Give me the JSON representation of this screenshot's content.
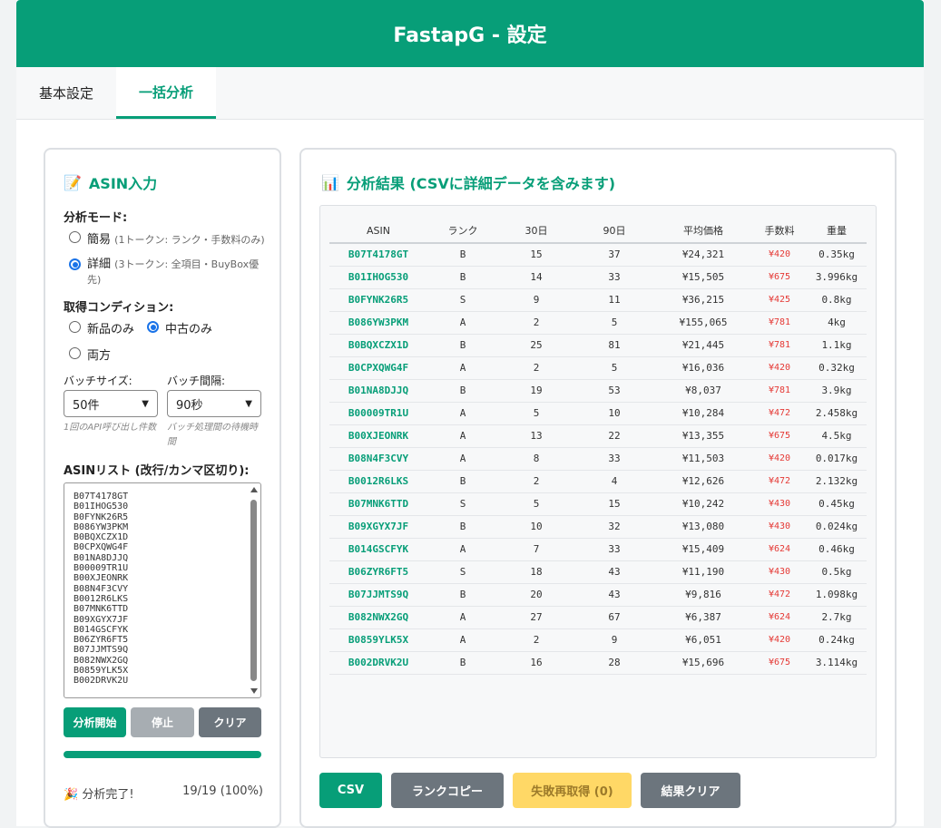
{
  "header": {
    "title": "FastapG - 設定"
  },
  "tabs": [
    {
      "label": "基本設定",
      "active": false
    },
    {
      "label": "一括分析",
      "active": true
    }
  ],
  "left": {
    "title": "ASIN入力",
    "title_icon": "memo-icon",
    "mode_label": "分析モード:",
    "mode_simple": {
      "label": "簡易",
      "note": "(1トークン: ランク・手数料のみ)",
      "checked": false
    },
    "mode_detail": {
      "label": "詳細",
      "note": "(3トークン: 全項目・BuyBox優先)",
      "checked": true
    },
    "condition_label": "取得コンディション:",
    "cond_new": {
      "label": "新品のみ",
      "checked": false
    },
    "cond_used": {
      "label": "中古のみ",
      "checked": true
    },
    "cond_both": {
      "label": "両方",
      "checked": false
    },
    "batch_size_label": "バッチサイズ:",
    "batch_size_value": "50件",
    "batch_size_hint": "1回のAPI呼び出し件数",
    "batch_interval_label": "バッチ間隔:",
    "batch_interval_value": "90秒",
    "batch_interval_hint": "バッチ処理間の待機時間",
    "asin_list_label": "ASINリスト (改行/カンマ区切り):",
    "asin_list": "B07T4178GT\nB01IHOG530\nB0FYNK26R5\nB086YW3PKM\nB0BQXCZX1D\nB0CPXQWG4F\nB01NA8DJJQ\nB00009TR1U\nB00XJEONRK\nB08N4F3CVY\nB0012R6LKS\nB07MNK6TTD\nB09XGYX7JF\nB014GSCFYK\nB06ZYR6FT5\nB07JJMTS9Q\nB082NWX2GQ\nB0859YLK5X\nB002DRVK2U",
    "btn_start": "分析開始",
    "btn_stop": "停止",
    "btn_clear": "クリア",
    "progress": 100,
    "status_text": "分析完了!",
    "status_icon": "party-popper-icon",
    "status_count": "19/19 (100%)"
  },
  "right": {
    "title": "分析結果 (CSVに詳細データを含みます)",
    "title_icon": "bar-chart-icon",
    "columns": [
      "ASIN",
      "ランク",
      "30日",
      "90日",
      "平均価格",
      "手数料",
      "重量"
    ],
    "rows": [
      [
        "B07T4178GT",
        "B",
        "15",
        "37",
        "¥24,321",
        "¥420",
        "0.35kg"
      ],
      [
        "B01IHOG530",
        "B",
        "14",
        "33",
        "¥15,505",
        "¥675",
        "3.996kg"
      ],
      [
        "B0FYNK26R5",
        "S",
        "9",
        "11",
        "¥36,215",
        "¥425",
        "0.8kg"
      ],
      [
        "B086YW3PKM",
        "A",
        "2",
        "5",
        "¥155,065",
        "¥781",
        "4kg"
      ],
      [
        "B0BQXCZX1D",
        "B",
        "25",
        "81",
        "¥21,445",
        "¥781",
        "1.1kg"
      ],
      [
        "B0CPXQWG4F",
        "A",
        "2",
        "5",
        "¥16,036",
        "¥420",
        "0.32kg"
      ],
      [
        "B01NA8DJJQ",
        "B",
        "19",
        "53",
        "¥8,037",
        "¥781",
        "3.9kg"
      ],
      [
        "B00009TR1U",
        "A",
        "5",
        "10",
        "¥10,284",
        "¥472",
        "2.458kg"
      ],
      [
        "B00XJEONRK",
        "A",
        "13",
        "22",
        "¥13,355",
        "¥675",
        "4.5kg"
      ],
      [
        "B08N4F3CVY",
        "A",
        "8",
        "33",
        "¥11,503",
        "¥420",
        "0.017kg"
      ],
      [
        "B0012R6LKS",
        "B",
        "2",
        "4",
        "¥12,626",
        "¥472",
        "2.132kg"
      ],
      [
        "B07MNK6TTD",
        "S",
        "5",
        "15",
        "¥10,242",
        "¥430",
        "0.45kg"
      ],
      [
        "B09XGYX7JF",
        "B",
        "10",
        "32",
        "¥13,080",
        "¥430",
        "0.024kg"
      ],
      [
        "B014GSCFYK",
        "A",
        "7",
        "33",
        "¥15,409",
        "¥624",
        "0.46kg"
      ],
      [
        "B06ZYR6FT5",
        "S",
        "18",
        "43",
        "¥11,190",
        "¥430",
        "0.5kg"
      ],
      [
        "B07JJMTS9Q",
        "B",
        "20",
        "43",
        "¥9,816",
        "¥472",
        "1.098kg"
      ],
      [
        "B082NWX2GQ",
        "A",
        "27",
        "67",
        "¥6,387",
        "¥624",
        "2.7kg"
      ],
      [
        "B0859YLK5X",
        "A",
        "2",
        "9",
        "¥6,051",
        "¥420",
        "0.24kg"
      ],
      [
        "B002DRVK2U",
        "B",
        "16",
        "28",
        "¥15,696",
        "¥675",
        "3.114kg"
      ]
    ],
    "btn_csv": "CSV",
    "btn_rank_copy": "ランクコピー",
    "btn_retry": "失敗再取得 (0)",
    "btn_clear_results": "結果クリア"
  },
  "colors": {
    "primary": "#079e78",
    "gray_button": "#6c757d",
    "disabled_button": "#a7adb2",
    "warning_button": "#ffd866",
    "fee_red": "#e53935"
  }
}
